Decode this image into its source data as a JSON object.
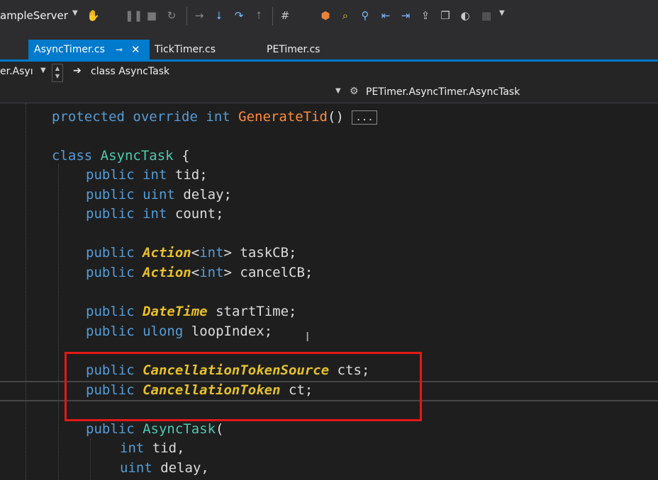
{
  "toolbar": {
    "project_name": "ampleServer",
    "icons": [
      "hand-icon",
      "pause-icon",
      "stop-icon",
      "restart-icon",
      "arrow-right-icon",
      "step-into-icon",
      "step-over-icon",
      "step-out-icon",
      "hash-icon",
      "breakpoint-icon",
      "find-icon",
      "search-icon",
      "left-arrow-icon",
      "right-arrow-icon",
      "open-folder-icon",
      "copy-icon",
      "toggle-icon",
      "grid-icon"
    ]
  },
  "tabs": [
    {
      "label": "AsyncTimer.cs",
      "active": true
    },
    {
      "label": "TickTimer.cs",
      "active": false
    },
    {
      "label": "PETimer.cs",
      "active": false
    }
  ],
  "nav": {
    "project_combo": "er.Asyı",
    "class_combo": "class AsyncTask",
    "member_combo": "PETimer.AsyncTimer.AsyncTask"
  },
  "code": {
    "line_1": {
      "k1": "protected",
      "k2": "override",
      "k3": "int",
      "method": "GenerateTid",
      "paren": "()",
      "ellipsis": "..."
    },
    "line_2": {
      "k1": "class",
      "type": "AsyncTask",
      "brace": "{"
    },
    "line_3": {
      "k1": "public",
      "k2": "int",
      "name": "tid;"
    },
    "line_4": {
      "k1": "public",
      "k2": "uint",
      "name": "delay;"
    },
    "line_5": {
      "k1": "public",
      "k2": "int",
      "name": "count;"
    },
    "line_6": {
      "k1": "public",
      "type": "Action",
      "lt": "<",
      "k2": "int",
      "gt": ">",
      "name": "taskCB;"
    },
    "line_7": {
      "k1": "public",
      "type": "Action",
      "lt": "<",
      "k2": "int",
      "gt": ">",
      "name": "cancelCB;"
    },
    "line_8": {
      "k1": "public",
      "type": "DateTime",
      "name": "startTime;"
    },
    "line_9": {
      "k1": "public",
      "k2": "ulong",
      "name": "loopIndex;"
    },
    "line_10": {
      "k1": "public",
      "type": "CancellationTokenSource",
      "name": "cts;"
    },
    "line_11": {
      "k1": "public",
      "type": "CancellationToken",
      "name": "ct;"
    },
    "line_12": {
      "k1": "public",
      "type": "AsyncTask",
      "paren": "("
    },
    "line_13": {
      "k2": "int",
      "name": "tid,"
    },
    "line_14": {
      "k2": "uint",
      "name": "delay,"
    }
  },
  "highlight_color": "#e41818"
}
